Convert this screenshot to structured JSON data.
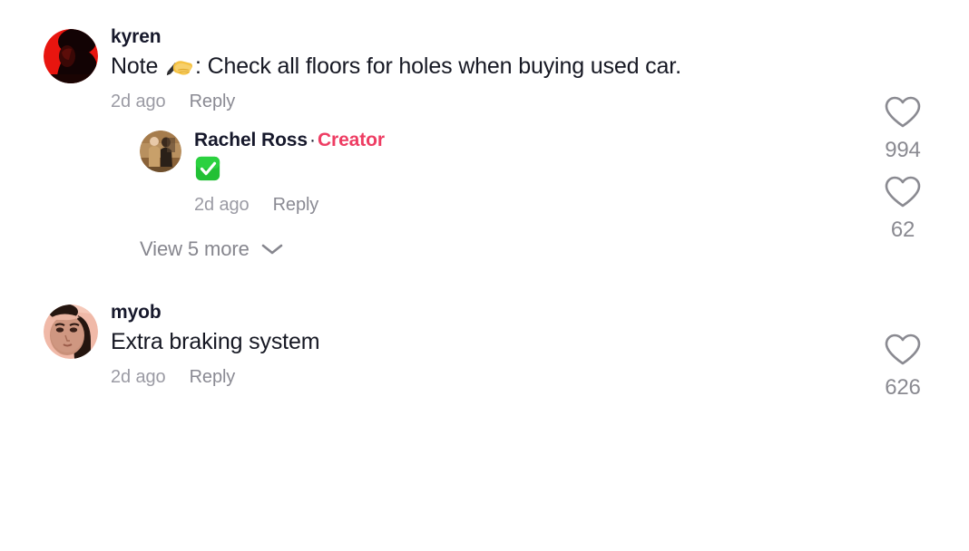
{
  "theme": {
    "background": "#ffffff",
    "text_primary": "#161823",
    "text_muted": "#9b9ba4",
    "creator_accent": "#ee3d63",
    "like_icon": "#8a8a91",
    "avatar_1_bg": "#e8150f",
    "avatar_3_bg": "#f0b9a8",
    "check_emoji_green": "#22c035"
  },
  "comments": [
    {
      "id": "comment-kyren",
      "username": "kyren",
      "avatar_name": "avatar-kyren",
      "text_before_emoji": "Note ",
      "emoji_name": "writing-hand-emoji",
      "text_after_emoji": ": Check all floors for holes when buying used car.",
      "full_text": "Note ✍️: Check all floors for holes when buying used car.",
      "timestamp": "2d ago",
      "reply_label": "Reply",
      "like_count": "994",
      "like_icon": "heart-icon"
    },
    {
      "id": "comment-myob",
      "username": "myob",
      "avatar_name": "avatar-myob",
      "full_text": "Extra braking system",
      "timestamp": "2d ago",
      "reply_label": "Reply",
      "like_count": "626",
      "like_icon": "heart-icon"
    }
  ],
  "reply": {
    "id": "reply-rachel-ross",
    "username": "Rachel Ross",
    "separator": "·",
    "badge": "Creator",
    "avatar_name": "avatar-rachel-ross",
    "emoji_name": "white-check-mark-emoji",
    "full_text": "✅",
    "timestamp": "2d ago",
    "reply_label": "Reply",
    "like_count": "62",
    "like_icon": "heart-icon"
  },
  "view_more": {
    "label": "View 5 more",
    "icon": "chevron-down-icon"
  }
}
